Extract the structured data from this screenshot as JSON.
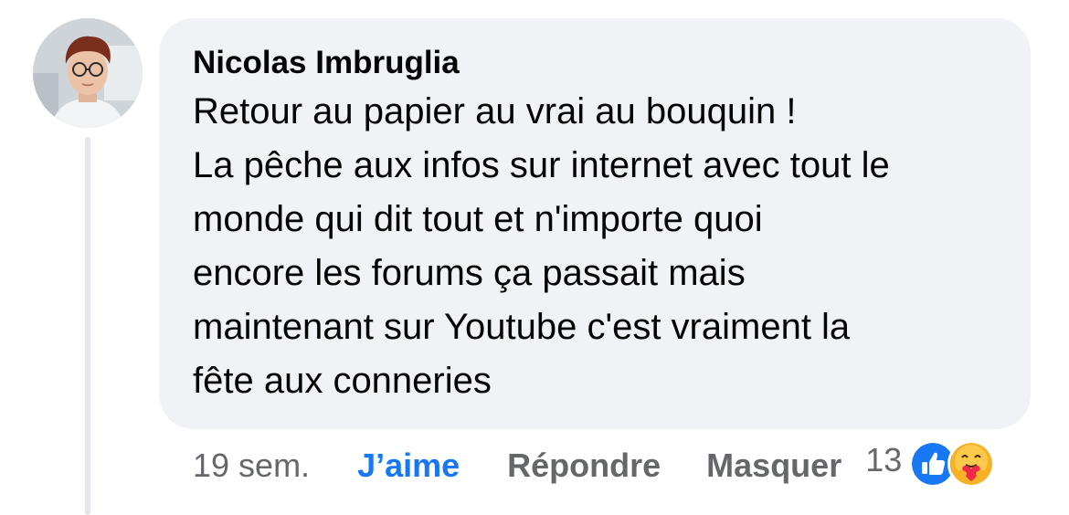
{
  "comment": {
    "author": "Nicolas Imbruglia",
    "lines": [
      "Retour au papier au vrai au bouquin !",
      "La pêche aux infos sur internet avec tout le",
      "monde qui dit tout et n'importe quoi",
      "encore les forums ça passait mais",
      "maintenant sur Youtube c'est vraiment la",
      "fête aux conneries"
    ]
  },
  "actions": {
    "timestamp": "19 sem.",
    "like_label": "J’aime",
    "reply_label": "Répondre",
    "hide_label": "Masquer"
  },
  "reactions": {
    "count": "13",
    "icons": [
      "like-icon",
      "care-icon"
    ]
  },
  "colors": {
    "bubble_bg": "#f0f2f5",
    "like_active": "#1877f2",
    "secondary_text": "#65676b",
    "primary_text": "#050505"
  }
}
